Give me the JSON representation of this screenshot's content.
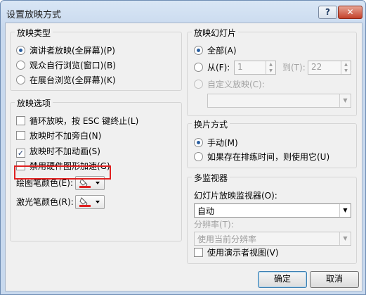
{
  "dialog": {
    "title": "设置放映方式",
    "help_label": "?",
    "close_label": "✕"
  },
  "show_type": {
    "label": "放映类型",
    "options": [
      "演讲者放映(全屏幕)(P)",
      "观众自行浏览(窗口)(B)",
      "在展台浏览(全屏幕)(K)"
    ],
    "selected": 0
  },
  "show_options": {
    "label": "放映选项",
    "items": [
      {
        "label": "循环放映，按 ESC 键终止(L)",
        "checked": false
      },
      {
        "label": "放映时不加旁白(N)",
        "checked": false
      },
      {
        "label": "放映时不加动画(S)",
        "checked": true
      },
      {
        "label": "禁用硬件图形加速(G)",
        "checked": false
      }
    ],
    "pen_color_label": "绘图笔颜色(E):",
    "laser_color_label": "激光笔颜色(R):",
    "pen_color": "#e02020",
    "laser_color": "#e02020"
  },
  "slides": {
    "label": "放映幻灯片",
    "all_label": "全部(A)",
    "from_label": "从(F):",
    "from_value": "1",
    "to_label": "到(T):",
    "to_value": "22",
    "custom_label": "自定义放映(C):"
  },
  "advance": {
    "label": "换片方式",
    "options": [
      "手动(M)",
      "如果存在排练时间，则使用它(U)"
    ],
    "selected": 0
  },
  "monitors": {
    "label": "多监视器",
    "monitor_label": "幻灯片放映监视器(O):",
    "monitor_value": "自动",
    "resolution_label": "分辨率(T):",
    "resolution_value": "使用当前分辨率",
    "presenter_view_label": "使用演示者视图(V)"
  },
  "buttons": {
    "ok": "确定",
    "cancel": "取消"
  }
}
